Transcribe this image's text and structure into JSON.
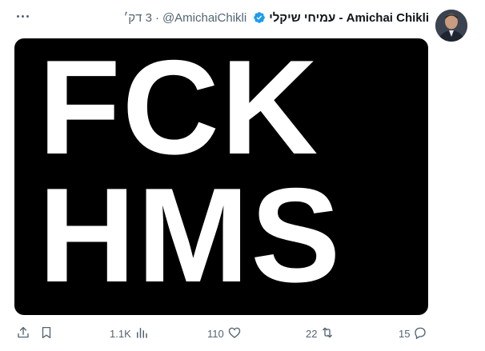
{
  "tweet": {
    "display_name": "עמיחי שיקלי - Amichai Chikli",
    "handle": "@AmichaiChikli",
    "separator": "·",
    "time": "3 דק׳",
    "media_text": [
      "FCK",
      "HMS"
    ]
  },
  "actions": {
    "replies": "15",
    "retweets": "22",
    "likes": "110",
    "views": "1.1K"
  },
  "colors": {
    "verified": "#1d9bf0",
    "secondary_text": "#536471",
    "media_background": "#000000"
  },
  "icons": [
    "more-icon",
    "verified-icon",
    "reply-icon",
    "retweet-icon",
    "like-icon",
    "views-icon",
    "bookmark-icon",
    "share-icon"
  ]
}
